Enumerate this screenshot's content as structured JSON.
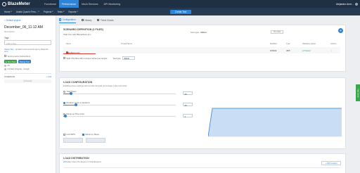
{
  "topbar": {
    "brand": "BlazeMeter",
    "nav": [
      "Functional",
      "Performance",
      "Mock Services",
      "API Monitoring"
    ],
    "active_nav": "Performance",
    "user": "Alejandro Arne..."
  },
  "subbar": {
    "items": [
      "Home",
      "Analiz Quant's Pers...",
      "Projects",
      "Tests",
      "Reports"
    ],
    "create_button": "Create Test"
  },
  "sidebar": {
    "back_link": "< Default project",
    "test_name": "December_06_11:12 AM",
    "description_label": "Description",
    "tags_label": "Tags",
    "tags_placeholder": "Add a Tag...",
    "note_highlight": "JMeter Test",
    "note_text": " · Updated a few seconds ago by Alejandro Arne",
    "email_checkbox": "Send email to Subscribers",
    "run_button": "► Run Test",
    "debug_button": "Debug Test",
    "stats": [
      "20",
      "US East (Virginia) - Google"
    ],
    "schedule_label": "SCHEDULE",
    "schedule_add": "+ Add",
    "no_events": "No Events"
  },
  "tabs": [
    "Configuration",
    "History",
    "Trend Charts"
  ],
  "scenario": {
    "title": "SCENARIO DEFINITION (1 FILES)",
    "start_line": "Start test with BlazeMeter.jmx",
    "test_type_label": "Test type:",
    "test_type_value": "JMeter",
    "test_data_button": "Test data",
    "columns": [
      "Name",
      "Thread Name",
      "Modified",
      "Type",
      "Validation status",
      "Actions"
    ],
    "row": {
      "name": "BlazeDemo.jmx",
      "modified": "12/6/22",
      "type": "JMX",
      "status": "● Passed"
    },
    "split_checkbox": "Split CSV files with a unique subset per engine",
    "test_type_select_label": "Test type",
    "test_type_select": "JMeter"
  },
  "load": {
    "title": "LOAD CONFIGURATION",
    "description": "Enabling these settings will override the load percentage in the test script",
    "sliders": [
      {
        "label": "Total Users",
        "value": "20",
        "radio": false,
        "fill": 0.07
      },
      {
        "label": "Duration (min) or Iterations",
        "value": "20",
        "radio": true,
        "fill": 0.11
      },
      {
        "label": "Ramp up Time (min)",
        "value": "1",
        "radio": false,
        "fill": 0.02
      }
    ],
    "limit_rps": "Limit RPS",
    "ramp_steps": "Ramp up Steps"
  },
  "distribution": {
    "title": "LOAD DISTRIBUTION",
    "description_prefix": "200",
    "description": " Max Users Per Engine in Total Engines",
    "add_location": "+ Add Location"
  },
  "side_tab": "Help Center",
  "colors": {
    "accent": "#2e84d6",
    "topbar": "#1f3045",
    "run": "#3aa54b",
    "error": "#e53935"
  }
}
